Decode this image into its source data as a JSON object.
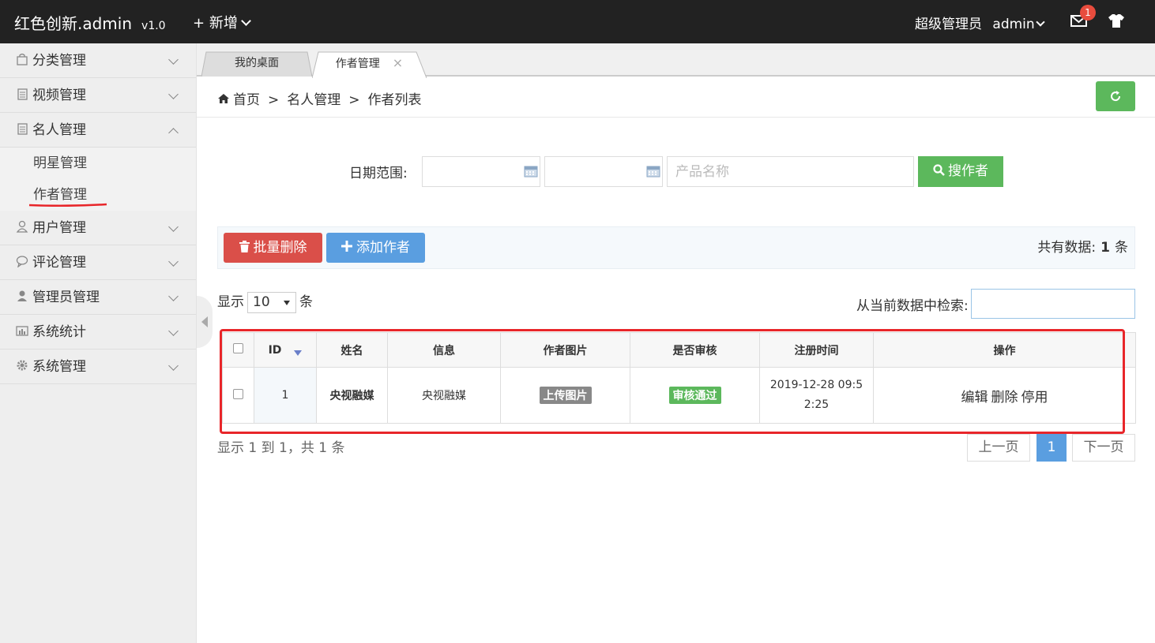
{
  "header": {
    "logo": "红色创新.admin",
    "version": "v1.0",
    "new_label": "新增",
    "user_role": "超级管理员",
    "user_name": "admin",
    "mail_badge": "1"
  },
  "sidebar": {
    "items": [
      {
        "label": "分类管理",
        "icon": "bag-icon"
      },
      {
        "label": "视频管理",
        "icon": "list-icon"
      },
      {
        "label": "名人管理",
        "icon": "list-icon",
        "expanded": true
      },
      {
        "label": "用户管理",
        "icon": "user-outline-icon"
      },
      {
        "label": "评论管理",
        "icon": "chat-icon"
      },
      {
        "label": "管理员管理",
        "icon": "user-solid-icon"
      },
      {
        "label": "系统统计",
        "icon": "bar-chart-icon"
      },
      {
        "label": "系统管理",
        "icon": "gear-icon"
      }
    ],
    "subitems": [
      {
        "label": "明星管理"
      },
      {
        "label": "作者管理",
        "active": true
      }
    ]
  },
  "tabs": [
    {
      "label": "我的桌面"
    },
    {
      "label": "作者管理",
      "close": "×"
    }
  ],
  "breadcrumb": {
    "home": "首页",
    "sep": ">",
    "level1": "名人管理",
    "level2": "作者列表"
  },
  "search": {
    "date_label": "日期范围:",
    "product_placeholder": "产品名称",
    "button": "搜作者"
  },
  "toolbar": {
    "batch_delete": "批量删除",
    "add_author": "添加作者",
    "total_prefix": "共有数据:",
    "total_count": "1",
    "total_suffix": "条"
  },
  "table_controls": {
    "show": "显示",
    "page_size": "10",
    "unit": "条",
    "filter_label": "从当前数据中检索:"
  },
  "table": {
    "headers": [
      "ID",
      "姓名",
      "信息",
      "作者图片",
      "是否审核",
      "注册时间",
      "操作"
    ],
    "rows": [
      {
        "id": "1",
        "name": "央视融媒",
        "info": "央视融媒",
        "image_btn": "上传图片",
        "review": "审核通过",
        "reg_time_line1": "2019-12-28 09:5",
        "reg_time_line2": "2:25",
        "op_edit": "编辑",
        "op_delete": "删除",
        "op_disable": "停用"
      }
    ]
  },
  "pagination": {
    "info": "显示 1 到 1，共 1 条",
    "prev": "上一页",
    "current": "1",
    "next": "下一页"
  },
  "colors": {
    "header_bg": "#222222",
    "success": "#5cb85c",
    "danger": "#da4f49",
    "primary": "#5a9ee0",
    "annotation_red": "#e8262a"
  }
}
